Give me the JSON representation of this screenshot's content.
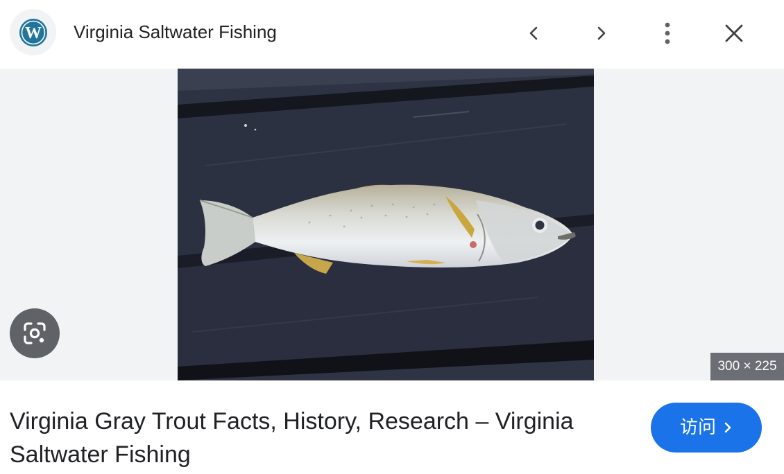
{
  "header": {
    "site_logo_icon": "wordpress-logo-icon",
    "site_name": "Virginia Saltwater Fishing",
    "prev_icon": "chevron-left-icon",
    "next_icon": "chevron-right-icon",
    "more_icon": "more-vert-icon",
    "close_icon": "close-icon"
  },
  "preview": {
    "image_alt": "Gray trout (weakfish) lying on dark wooden planks",
    "dimensions": "300 × 225",
    "lens_icon": "google-lens-icon"
  },
  "result": {
    "title": "Virginia Gray Trout Facts, History, Research – Virginia Saltwater Fishing",
    "visit_label": "访问",
    "visit_icon": "chevron-right-icon"
  },
  "colors": {
    "accent": "#1a73e8",
    "stage_background": "#f1f3f4",
    "lens_button": "#5f6368",
    "wordpress_blue": "#21759b"
  }
}
